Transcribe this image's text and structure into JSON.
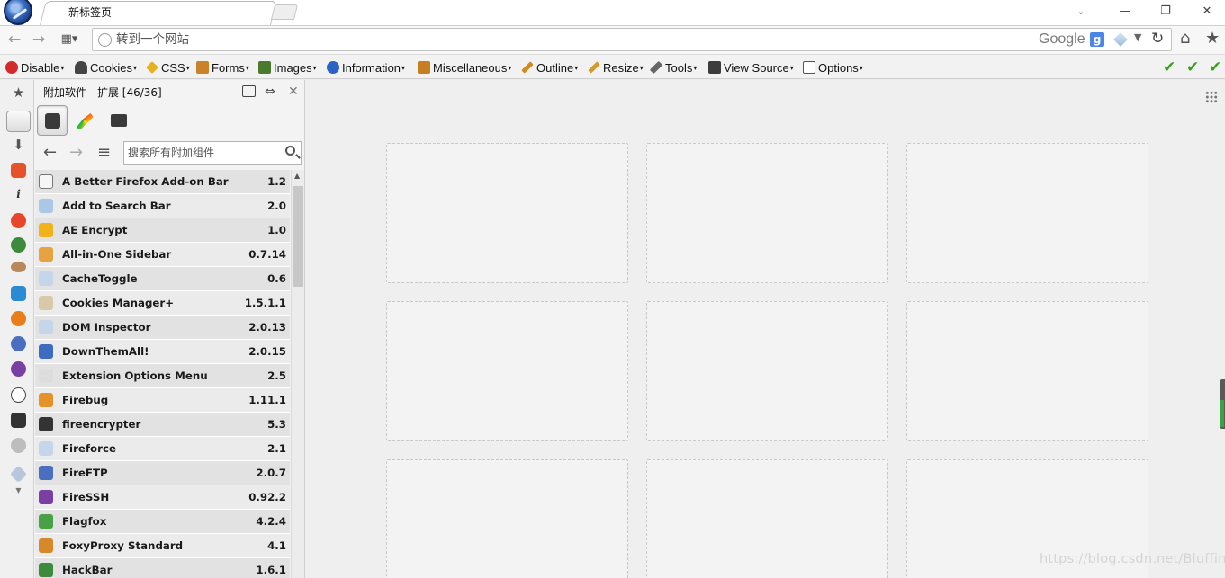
{
  "tab": {
    "title": "新标签页"
  },
  "window_controls": {
    "chevron": "⌄",
    "minimize": "—",
    "restore": "❐",
    "close": "✕"
  },
  "nav": {
    "back_icon": "arrow-left-icon",
    "forward_icon": "arrow-right-icon",
    "grid_icon": "grid-icon",
    "url_placeholder": "转到一个网站",
    "search_engine": "Google",
    "search_engine_badge": "g",
    "reload_glyph": "↻",
    "home_glyph": "⌂",
    "bookmark_glyph": "★"
  },
  "devbar": {
    "items": [
      {
        "label": "Disable",
        "icon": "disable-icon",
        "color": "#d12b2b"
      },
      {
        "label": "Cookies",
        "icon": "cookies-icon",
        "color": "#444444"
      },
      {
        "label": "CSS",
        "icon": "css-icon",
        "color": "#e6b01e"
      },
      {
        "label": "Forms",
        "icon": "forms-icon",
        "color": "#c9822a"
      },
      {
        "label": "Images",
        "icon": "images-icon",
        "color": "#4a7a2c"
      },
      {
        "label": "Information",
        "icon": "information-icon",
        "color": "#2b63c4"
      },
      {
        "label": "Miscellaneous",
        "icon": "miscellaneous-icon",
        "color": "#c77e1f"
      },
      {
        "label": "Outline",
        "icon": "outline-icon",
        "color": "#d08a1d"
      },
      {
        "label": "Resize",
        "icon": "resize-icon",
        "color": "#d59b2a"
      },
      {
        "label": "Tools",
        "icon": "tools-icon",
        "color": "#666666"
      },
      {
        "label": "View Source",
        "icon": "view-source-icon",
        "color": "#3c3c3c"
      },
      {
        "label": "Options",
        "icon": "options-icon",
        "color": "#555555"
      }
    ],
    "check_glyph": "✔",
    "check_color": "#3f9c1e"
  },
  "sidebar": {
    "title": "附加软件 - 扩展 [46/36]",
    "search_placeholder": "搜索所有附加组件",
    "header_icons": [
      "open-in-tab-icon",
      "swap-icon",
      "close-icon"
    ],
    "close_glyph": "✕",
    "swap_glyph": "⇔",
    "back_glyph": "←",
    "forward_glyph": "→",
    "menu_glyph": "≡",
    "categories": [
      "extensions-icon",
      "themes-icon",
      "plugins-icon"
    ],
    "addons": [
      {
        "name": "A Better Firefox Add-on Bar",
        "version": "1.2",
        "icon_color": "#f6f6f6"
      },
      {
        "name": "Add to Search Bar",
        "version": "2.0",
        "icon_color": "#aac7e6"
      },
      {
        "name": "AE Encrypt",
        "version": "1.0",
        "icon_color": "#f1b31a"
      },
      {
        "name": "All-in-One Sidebar",
        "version": "0.7.14",
        "icon_color": "#e7a33f"
      },
      {
        "name": "CacheToggle",
        "version": "0.6",
        "icon_color": "#c6d6ea"
      },
      {
        "name": "Cookies Manager+",
        "version": "1.5.1.1",
        "icon_color": "#d9c9a8"
      },
      {
        "name": "DOM Inspector",
        "version": "2.0.13",
        "icon_color": "#c6d6ea"
      },
      {
        "name": "DownThemAll!",
        "version": "2.0.15",
        "icon_color": "#3c6cc0"
      },
      {
        "name": "Extension Options Menu",
        "version": "2.5",
        "icon_color": "#dddddd"
      },
      {
        "name": "Firebug",
        "version": "1.11.1",
        "icon_color": "#e5922a"
      },
      {
        "name": "fireencrypter",
        "version": "5.3",
        "icon_color": "#333333"
      },
      {
        "name": "Fireforce",
        "version": "2.1",
        "icon_color": "#c6d6ea"
      },
      {
        "name": "FireFTP",
        "version": "2.0.7",
        "icon_color": "#4a6fc0"
      },
      {
        "name": "FireSSH",
        "version": "0.92.2",
        "icon_color": "#7a3fa3"
      },
      {
        "name": "Flagfox",
        "version": "4.2.4",
        "icon_color": "#4aa046"
      },
      {
        "name": "FoxyProxy Standard",
        "version": "4.1",
        "icon_color": "#d6882a"
      },
      {
        "name": "HackBar",
        "version": "1.6.1",
        "icon_color": "#3c8a3c"
      }
    ]
  },
  "content": {
    "watermark": "https://blog.csdn.net/Bluffing",
    "grid_icon": "speed-dial-grid-icon",
    "dials": 9
  }
}
